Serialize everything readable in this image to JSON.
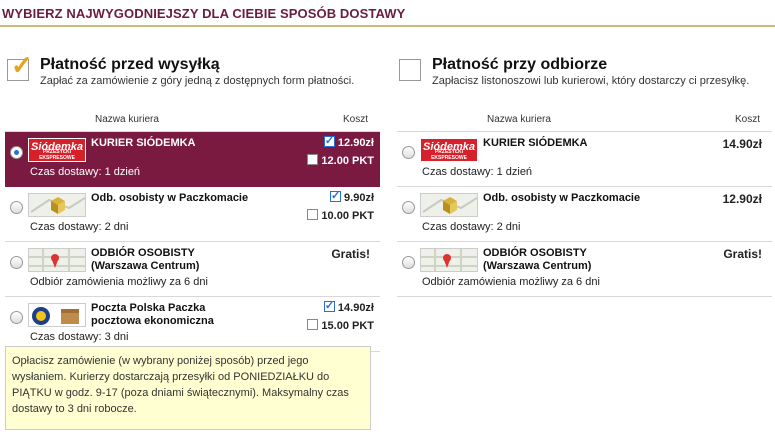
{
  "header": {
    "title": "WYBIERZ NAJWYGODNIEJSZY DLA CIEBIE SPOSÓB DOSTAWY"
  },
  "left": {
    "title": "Płatność przed wysyłką",
    "description": "Zapłać za zamówienie z góry jedną z dostępnych form płatności.",
    "col_name": "Nazwa kuriera",
    "col_cost": "Koszt",
    "rows": [
      {
        "name": "KURIER SIÓDEMKA",
        "sub": "Czas dostawy: 1 dzień",
        "price1": "12.90zł",
        "price2": "12.00 PKT"
      },
      {
        "name": "Odb. osobisty w Paczkomacie",
        "sub": "Czas dostawy: 2 dni",
        "price1": "9.90zł",
        "price2": "10.00 PKT"
      },
      {
        "name": "ODBIÓR OSOBISTY",
        "name2": "(Warszawa Centrum)",
        "sub": "Odbiór zamówienia możliwy za 6 dni",
        "price1": "Gratis!"
      },
      {
        "name": "Poczta Polska Paczka",
        "name2": "pocztowa ekonomiczna",
        "sub": "Czas dostawy: 3 dni",
        "price1": "14.90zł",
        "price2": "15.00 PKT"
      }
    ],
    "note": "Opłacisz zamówienie (w wybrany poniżej sposób) przed jego wysłaniem. Kurierzy dostarczają przesyłki od PONIEDZIAŁKU do PIĄTKU w godz. 9-17 (poza dniami świątecznymi). Maksymalny czas dostawy to 3 dni robocze."
  },
  "right": {
    "title": "Płatność przy odbiorze",
    "description": "Zapłacisz listonoszowi lub kurierowi, który dostarczy ci przesyłkę.",
    "col_name": "Nazwa kuriera",
    "col_cost": "Koszt",
    "rows": [
      {
        "name": "KURIER SIÓDEMKA",
        "sub": "Czas dostawy: 1 dzień",
        "price": "14.90zł"
      },
      {
        "name": "Odb. osobisty w Paczkomacie",
        "sub": "Czas dostawy: 2 dni",
        "price": "12.90zł"
      },
      {
        "name": "ODBIÓR OSOBISTY",
        "name2": "(Warszawa Centrum)",
        "sub": "Odbiór zamówienia możliwy za 6 dni",
        "price": "Gratis!"
      }
    ]
  },
  "logos": {
    "siodemka": "Siódemka",
    "siodemka_tag": "PRZESYŁKI EKSPRESOWE"
  },
  "colors": {
    "selected_row": "#7a1a40",
    "header_text": "#6b1d3f",
    "note_bg": "#ffffd2",
    "check_tick": "#e8a317"
  }
}
